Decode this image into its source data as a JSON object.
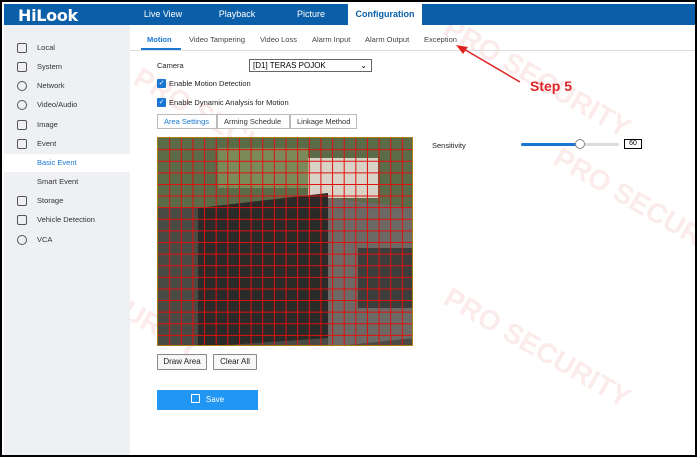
{
  "header": {
    "logo": "HiLook",
    "tabs": [
      {
        "label": "Live View"
      },
      {
        "label": "Playback"
      },
      {
        "label": "Picture"
      },
      {
        "label": "Configuration",
        "active": true
      }
    ]
  },
  "sidebar": {
    "items": [
      {
        "label": "Local",
        "icon": "monitor-icon"
      },
      {
        "label": "System",
        "icon": "system-icon"
      },
      {
        "label": "Network",
        "icon": "globe-icon"
      },
      {
        "label": "Video/Audio",
        "icon": "audio-icon"
      },
      {
        "label": "Image",
        "icon": "image-icon"
      },
      {
        "label": "Event",
        "icon": "calendar-icon"
      },
      {
        "label": "Basic Event",
        "sub": true,
        "active": true
      },
      {
        "label": "Smart Event",
        "sub": true
      },
      {
        "label": "Storage",
        "icon": "storage-icon"
      },
      {
        "label": "Vehicle Detection",
        "icon": "car-icon"
      },
      {
        "label": "VCA",
        "icon": "vca-icon"
      }
    ]
  },
  "subtabs": [
    "Motion",
    "Video Tampering",
    "Video Loss",
    "Alarm Input",
    "Alarm Output",
    "Exception"
  ],
  "form": {
    "camera_label": "Camera",
    "camera_value": "[D1] TERAS POJOK",
    "enable_motion": "Enable Motion Detection",
    "enable_dynamic": "Enable Dynamic Analysis for Motion"
  },
  "steps": [
    "Area Settings",
    "Arming Schedule",
    "Linkage Method"
  ],
  "sensitivity": {
    "label": "Sensitivity",
    "value": "60",
    "level": 0.6
  },
  "buttons": {
    "draw_area": "Draw Area",
    "clear_all": "Clear All",
    "save": "Save"
  },
  "annotation": {
    "label": "Step 5"
  },
  "watermark": "PRO SECURITY",
  "colors": {
    "brand": "#0b5fa8",
    "accent": "#1977d2",
    "save": "#2196f3",
    "annotation": "#e02424",
    "grid": "#e01010"
  }
}
